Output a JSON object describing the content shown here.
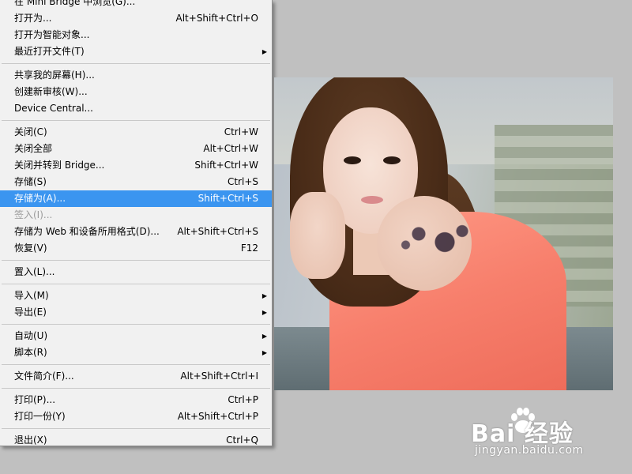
{
  "menu": {
    "items": [
      {
        "label": "在 Mini Bridge 中浏览(G)...",
        "shortcut": "",
        "submenu": false,
        "disabled": false,
        "highlight": false
      },
      {
        "label": "打开为...",
        "shortcut": "Alt+Shift+Ctrl+O",
        "submenu": false,
        "disabled": false,
        "highlight": false
      },
      {
        "label": "打开为智能对象...",
        "shortcut": "",
        "submenu": false,
        "disabled": false,
        "highlight": false
      },
      {
        "label": "最近打开文件(T)",
        "shortcut": "",
        "submenu": true,
        "disabled": false,
        "highlight": false
      },
      {
        "label": "共享我的屏幕(H)...",
        "shortcut": "",
        "submenu": false,
        "disabled": false,
        "highlight": false
      },
      {
        "label": "创建新审核(W)...",
        "shortcut": "",
        "submenu": false,
        "disabled": false,
        "highlight": false
      },
      {
        "label": "Device Central...",
        "shortcut": "",
        "submenu": false,
        "disabled": false,
        "highlight": false
      },
      {
        "label": "关闭(C)",
        "shortcut": "Ctrl+W",
        "submenu": false,
        "disabled": false,
        "highlight": false
      },
      {
        "label": "关闭全部",
        "shortcut": "Alt+Ctrl+W",
        "submenu": false,
        "disabled": false,
        "highlight": false
      },
      {
        "label": "关闭并转到 Bridge...",
        "shortcut": "Shift+Ctrl+W",
        "submenu": false,
        "disabled": false,
        "highlight": false
      },
      {
        "label": "存储(S)",
        "shortcut": "Ctrl+S",
        "submenu": false,
        "disabled": false,
        "highlight": false
      },
      {
        "label": "存储为(A)...",
        "shortcut": "Shift+Ctrl+S",
        "submenu": false,
        "disabled": false,
        "highlight": true
      },
      {
        "label": "签入(I)...",
        "shortcut": "",
        "submenu": false,
        "disabled": true,
        "highlight": false
      },
      {
        "label": "存储为 Web 和设备所用格式(D)...",
        "shortcut": "Alt+Shift+Ctrl+S",
        "submenu": false,
        "disabled": false,
        "highlight": false
      },
      {
        "label": "恢复(V)",
        "shortcut": "F12",
        "submenu": false,
        "disabled": false,
        "highlight": false
      },
      {
        "label": "置入(L)...",
        "shortcut": "",
        "submenu": false,
        "disabled": false,
        "highlight": false
      },
      {
        "label": "导入(M)",
        "shortcut": "",
        "submenu": true,
        "disabled": false,
        "highlight": false
      },
      {
        "label": "导出(E)",
        "shortcut": "",
        "submenu": true,
        "disabled": false,
        "highlight": false
      },
      {
        "label": "自动(U)",
        "shortcut": "",
        "submenu": true,
        "disabled": false,
        "highlight": false
      },
      {
        "label": "脚本(R)",
        "shortcut": "",
        "submenu": true,
        "disabled": false,
        "highlight": false
      },
      {
        "label": "文件简介(F)...",
        "shortcut": "Alt+Shift+Ctrl+I",
        "submenu": false,
        "disabled": false,
        "highlight": false
      },
      {
        "label": "打印(P)...",
        "shortcut": "Ctrl+P",
        "submenu": false,
        "disabled": false,
        "highlight": false
      },
      {
        "label": "打印一份(Y)",
        "shortcut": "Alt+Shift+Ctrl+P",
        "submenu": false,
        "disabled": false,
        "highlight": false
      },
      {
        "label": "退出(X)",
        "shortcut": "Ctrl+Q",
        "submenu": false,
        "disabled": false,
        "highlight": false
      }
    ]
  },
  "colors": {
    "menu_background": "#f1f1f1",
    "highlight": "#3b95f0",
    "workspace": "#c0c0c0",
    "disabled_text": "#9c9c9c"
  },
  "icons": {
    "submenu_arrow": "▶",
    "watermark_paw": "paw-icon"
  },
  "watermark": {
    "logo": "Bai 经验",
    "url": "jingyan.baidu.com"
  }
}
